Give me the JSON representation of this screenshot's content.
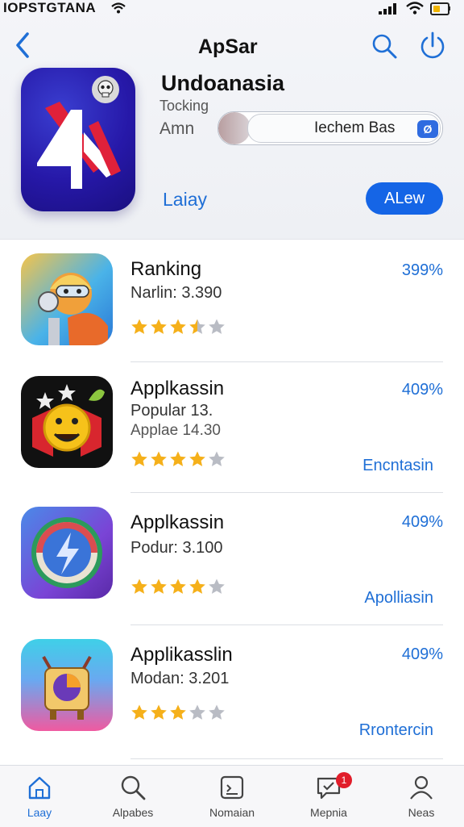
{
  "status_bar": {
    "carrier": "IOPSTGTANA"
  },
  "nav": {
    "title": "ApSar"
  },
  "hero": {
    "app_name": "Undoanasia",
    "subtitle1": "Tocking",
    "subtitle2": "Amn",
    "toggle_text": "Iechem Bas",
    "toggle_badge": "Ø",
    "left_link": "Laiay",
    "primary_button": "ALew"
  },
  "rows": [
    {
      "title": "Ranking",
      "line1": "Narlin: 3.390",
      "line2": "",
      "percent": "399%",
      "action": "",
      "rating": 3.5
    },
    {
      "title": "Applkassin",
      "line1": "Popular 13.",
      "line2": "Applae 14.30",
      "percent": "409%",
      "action": "Encntasin",
      "rating": 4
    },
    {
      "title": "Applkassin",
      "line1": "Podur: 3.100",
      "line2": "",
      "percent": "409%",
      "action": "Apolliasin",
      "rating": 4
    },
    {
      "title": "Applikasslin",
      "line1": "Modan: 3.201",
      "line2": "",
      "percent": "409%",
      "action": "Rrontercin",
      "rating": 3
    }
  ],
  "tabs": [
    {
      "label": "Laay",
      "icon": "home-icon"
    },
    {
      "label": "Alpabes",
      "icon": "search-icon"
    },
    {
      "label": "Nomaian",
      "icon": "inbox-icon"
    },
    {
      "label": "Mepnia",
      "icon": "chat-check-icon",
      "badge": "1"
    },
    {
      "label": "Neas",
      "icon": "person-icon"
    }
  ],
  "colors": {
    "accent": "#1f6fd6",
    "primary_button": "#1565e6",
    "star": "#f5b01a",
    "star_empty": "#b9bcc4",
    "badge": "#e11d2a"
  }
}
